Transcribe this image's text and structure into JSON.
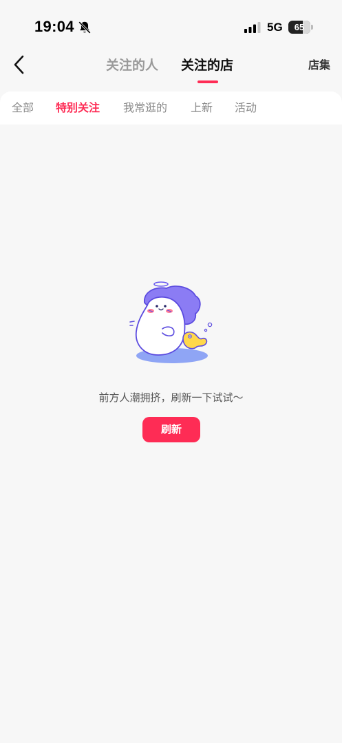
{
  "status_bar": {
    "time": "19:04",
    "network": "5G",
    "battery_level": "65",
    "battery_percent": 65,
    "icons": [
      "bell-off-icon",
      "signal-icon",
      "battery-icon"
    ]
  },
  "header": {
    "back_icon": "chevron-left-icon",
    "tabs": [
      {
        "label": "关注的人",
        "active": false
      },
      {
        "label": "关注的店",
        "active": true
      }
    ],
    "right_link": "店集",
    "accent_color": "#fe2c55"
  },
  "filter_tabs": [
    {
      "label": "全部",
      "active": false
    },
    {
      "label": "特别关注",
      "active": true
    },
    {
      "label": "我常逛的",
      "active": false
    },
    {
      "label": "上新",
      "active": false
    },
    {
      "label": "活动",
      "active": false
    }
  ],
  "empty_state": {
    "illustration": "mascot-illustration",
    "message": "前方人潮拥挤，刷新一下试试～",
    "button_label": "刷新"
  }
}
